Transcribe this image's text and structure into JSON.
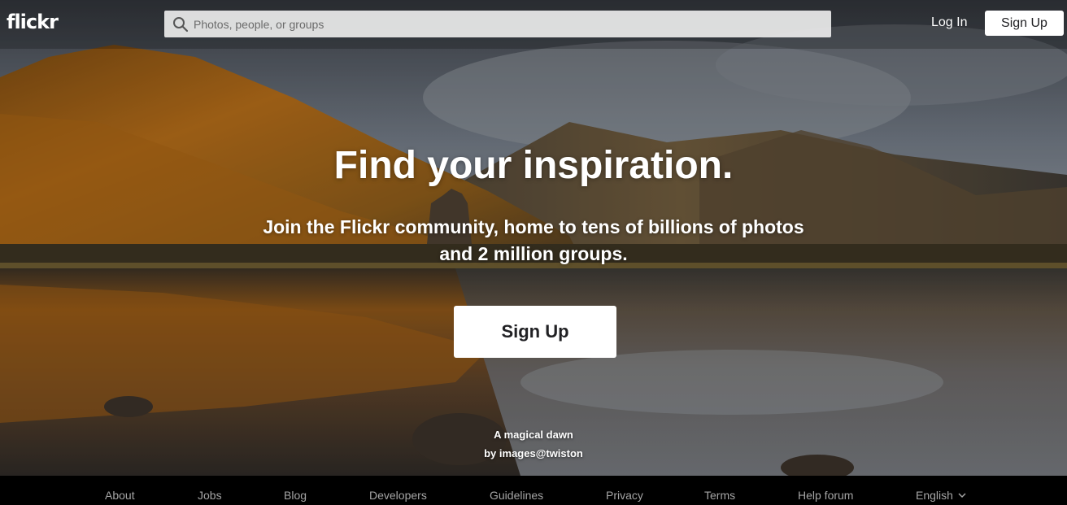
{
  "header": {
    "logo": "flickr",
    "search_placeholder": "Photos, people, or groups",
    "login_label": "Log In",
    "signup_label": "Sign Up"
  },
  "hero": {
    "headline": "Find your inspiration.",
    "subhead": "Join the Flickr community, home to tens of billions of photos and 2 million groups.",
    "cta_label": "Sign Up",
    "photo_title": "A magical dawn",
    "photo_author": "by images@twiston"
  },
  "footer": {
    "links": [
      "About",
      "Jobs",
      "Blog",
      "Developers",
      "Guidelines",
      "Privacy",
      "Terms",
      "Help forum"
    ],
    "language": "English"
  },
  "colors": {
    "button_bg": "#ffffff",
    "button_text": "#212124",
    "footer_bg": "#000000",
    "footer_text": "#a5a5a5"
  },
  "icons": [
    "search-icon",
    "chevron-down-icon"
  ]
}
